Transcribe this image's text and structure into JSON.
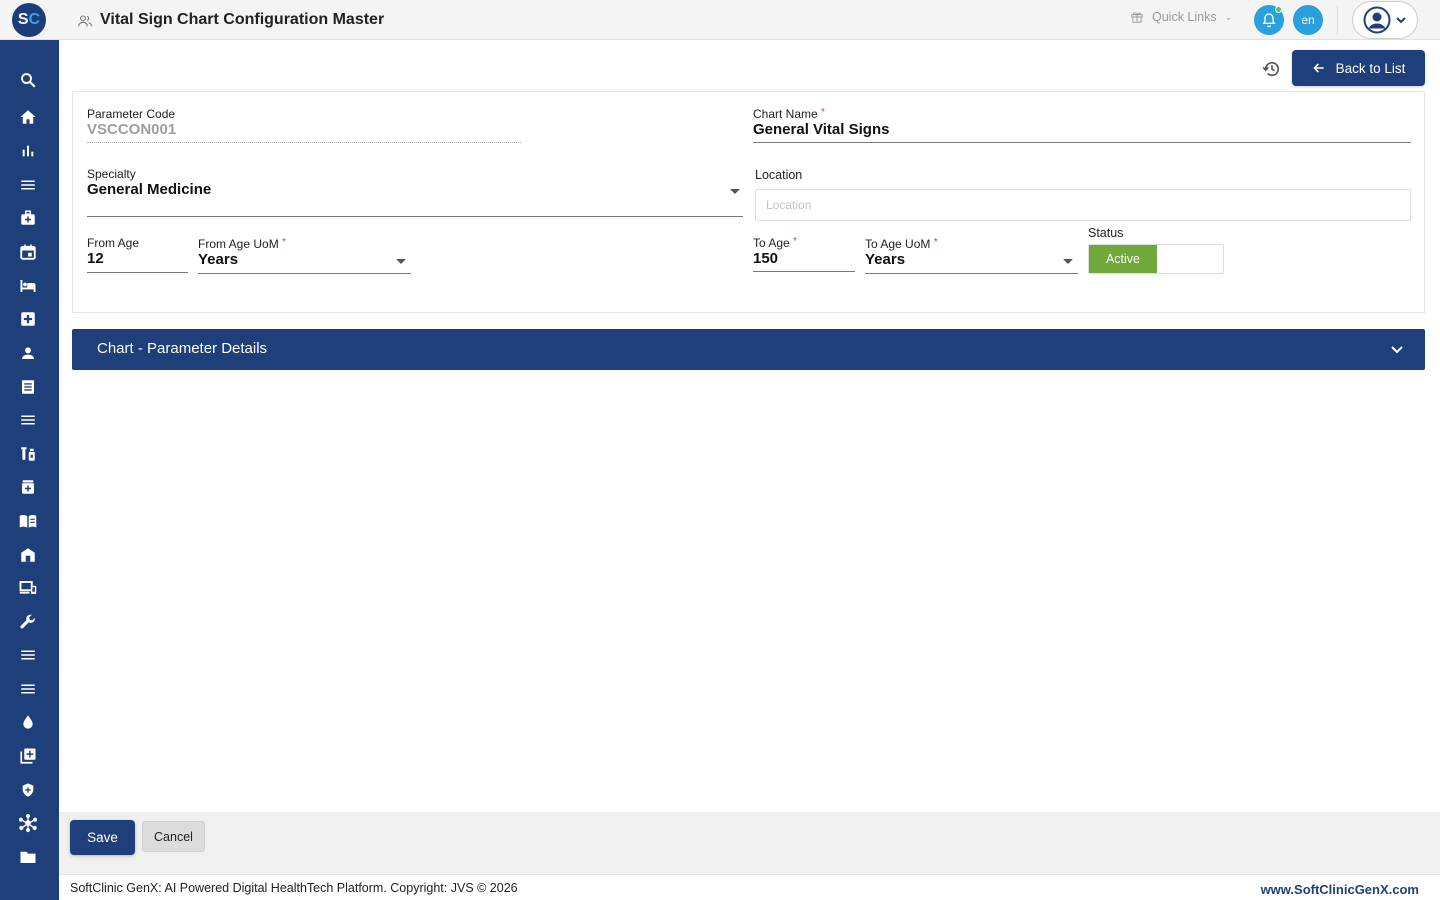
{
  "app": {
    "logo_s": "S",
    "logo_c": "C",
    "page_title": "Vital Sign Chart Configuration Master"
  },
  "header": {
    "quick_links": "Quick Links",
    "lang": "en"
  },
  "sidebar": {
    "icons": [
      "search-icon",
      "home-icon",
      "bar-chart-icon",
      "menu-icon",
      "medical-bag-icon",
      "calendar-icon",
      "bed-icon",
      "medical-plus-icon",
      "person-icon",
      "document-icon",
      "menu-icon",
      "lab-icon",
      "pharmacy-icon",
      "book-icon",
      "store-icon",
      "devices-icon",
      "wrench-icon",
      "menu-icon",
      "menu-icon",
      "blood-drop-icon",
      "add-box-icon",
      "shield-icon",
      "network-icon",
      "folder-icon"
    ]
  },
  "toolbar": {
    "back_label": "Back to List"
  },
  "form": {
    "parameter_code_label": "Parameter Code",
    "parameter_code_value": "VSCCON001",
    "chart_name_label": "Chart Name",
    "chart_name_value": "General Vital Signs",
    "specialty_label": "Specialty",
    "specialty_value": "General Medicine",
    "location_label": "Location",
    "location_placeholder": "Location",
    "from_age_label": "From Age",
    "from_age_value": "12",
    "from_age_uom_label": "From Age UoM",
    "from_age_uom_value": "Years",
    "to_age_label": "To Age",
    "to_age_value": "150",
    "to_age_uom_label": "To Age UoM",
    "to_age_uom_value": "Years",
    "status_label": "Status",
    "status_value": "Active",
    "required_mark": "*"
  },
  "accordion": {
    "title": "Chart - Parameter Details"
  },
  "actions": {
    "save_label": "Save",
    "cancel_label": "Cancel"
  },
  "footer": {
    "copyright": "SoftClinic GenX: AI Powered Digital HealthTech Platform. Copyright: JVS © 2026",
    "website": "www.SoftClinicGenX.com"
  },
  "colors": {
    "primary": "#1f3f7b",
    "accent": "#2aa0dc",
    "active_green": "#71a83b"
  }
}
